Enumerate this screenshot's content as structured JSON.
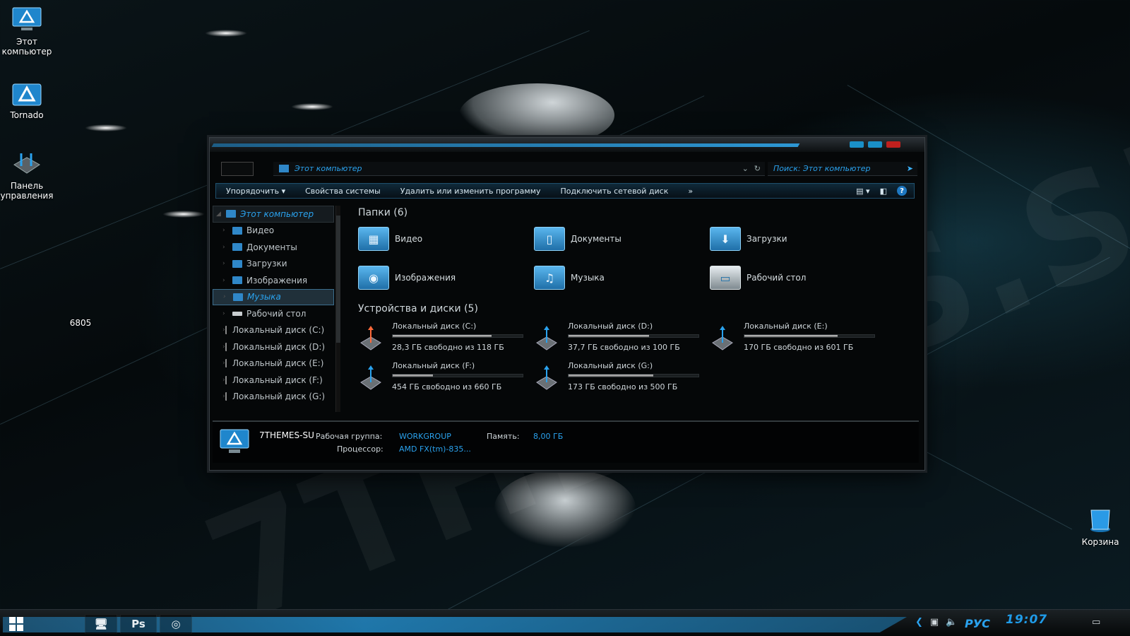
{
  "desktop": {
    "icons": [
      {
        "label": "Этот компьютер"
      },
      {
        "label": "Tornado"
      },
      {
        "label": "Панель управления"
      },
      {
        "label": "6805"
      },
      {
        "label": "Корзина"
      }
    ]
  },
  "window": {
    "address": {
      "location": "Этот компьютер"
    },
    "search": {
      "placeholder": "Поиск: Этот компьютер"
    },
    "toolbar": {
      "organize": "Упорядочить ▾",
      "system_properties": "Свойства системы",
      "uninstall": "Удалить или изменить программу",
      "map_drive": "Подключить сетевой диск",
      "more": "»",
      "help": "?"
    },
    "nav": {
      "root": "Этот компьютер",
      "items": [
        {
          "label": "Видео"
        },
        {
          "label": "Документы"
        },
        {
          "label": "Загрузки"
        },
        {
          "label": "Изображения"
        },
        {
          "label": "Музыка"
        },
        {
          "label": "Рабочий стол"
        },
        {
          "label": "Локальный диск (C:)"
        },
        {
          "label": "Локальный диск (D:)"
        },
        {
          "label": "Локальный диск (E:)"
        },
        {
          "label": "Локальный диск (F:)"
        },
        {
          "label": "Локальный диск (G:)"
        }
      ],
      "selected": "Музыка"
    },
    "folders_title": "Папки (6)",
    "folders": [
      {
        "label": "Видео",
        "icon": "video-folder-icon"
      },
      {
        "label": "Документы",
        "icon": "documents-folder-icon"
      },
      {
        "label": "Загрузки",
        "icon": "downloads-folder-icon"
      },
      {
        "label": "Изображения",
        "icon": "pictures-folder-icon"
      },
      {
        "label": "Музыка",
        "icon": "music-folder-icon"
      },
      {
        "label": "Рабочий стол",
        "icon": "desktop-folder-icon"
      }
    ],
    "drives_title": "Устройства и диски (5)",
    "drives": [
      {
        "name": "Локальный диск (C:)",
        "free": "28,3 ГБ свободно из 118 ГБ",
        "used_fraction": 0.76
      },
      {
        "name": "Локальный диск (D:)",
        "free": "37,7 ГБ свободно из 100 ГБ",
        "used_fraction": 0.62
      },
      {
        "name": "Локальный диск (E:)",
        "free": "170 ГБ свободно из 601 ГБ",
        "used_fraction": 0.72
      },
      {
        "name": "Локальный диск (F:)",
        "free": "454 ГБ свободно из 660 ГБ",
        "used_fraction": 0.31
      },
      {
        "name": "Локальный диск (G:)",
        "free": "173 ГБ свободно из 500 ГБ",
        "used_fraction": 0.65
      }
    ],
    "details": {
      "computer_name": "7THEMES-SU",
      "workgroup_label": "Рабочая группа:",
      "workgroup": "WORKGROUP",
      "memory_label": "Память:",
      "memory": "8,00 ГБ",
      "cpu_label": "Процессор:",
      "cpu": "AMD FX(tm)-835..."
    }
  },
  "taskbar": {
    "ps_label": "Ps",
    "lang": "РУС",
    "clock": "19:07"
  },
  "colors": {
    "accent": "#2aa2ee",
    "toolbar_border": "#1e4f6c",
    "close_button": "#c0201e",
    "min_button": "#1a90c8"
  }
}
